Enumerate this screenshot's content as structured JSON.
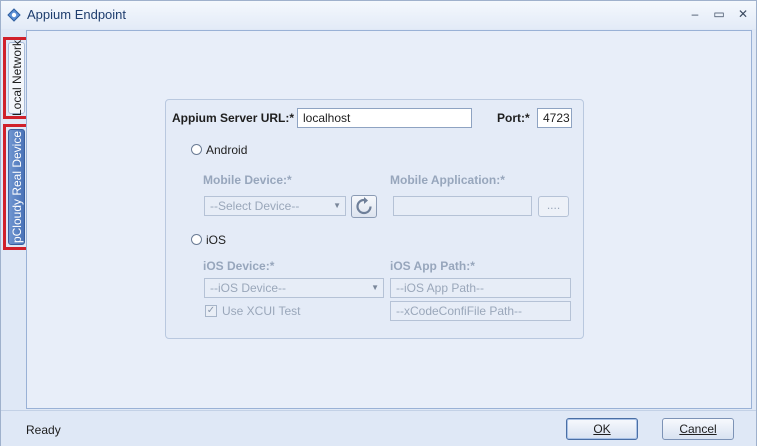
{
  "window": {
    "title": "Appium Endpoint",
    "minimize_glyph": "–",
    "maximize_glyph": "▭",
    "close_glyph": "✕"
  },
  "side_tabs": [
    {
      "label": "Local Network",
      "selected": false
    },
    {
      "label": "pCloudy Real Device",
      "selected": true
    }
  ],
  "form": {
    "server_url_label": "Appium Server URL:*",
    "server_url_value": "localhost",
    "port_label": "Port:*",
    "port_value": "4723",
    "android_radio_label": "Android",
    "mobile_device_label": "Mobile Device:*",
    "mobile_device_value": "--Select Device--",
    "mobile_app_label": "Mobile Application:*",
    "mobile_app_value": "",
    "browse_label": "....",
    "ios_radio_label": "iOS",
    "ios_device_label": "iOS Device:*",
    "ios_device_value": "--iOS Device--",
    "ios_app_path_label": "iOS App Path:*",
    "ios_app_path_placeholder": "--iOS App Path--",
    "xcode_placeholder": "--xCodeConfiFile Path--",
    "use_xcui_label": "Use XCUI Test",
    "use_xcui_checked": true
  },
  "status": {
    "text": "Ready"
  },
  "buttons": {
    "ok": "OK",
    "cancel": "Cancel"
  },
  "colors": {
    "accent": "#4a73b8",
    "highlight": "#d0202a"
  },
  "icons": {
    "app": "appium-icon",
    "refresh": "refresh-icon",
    "combo": "chevron-down-icon"
  }
}
